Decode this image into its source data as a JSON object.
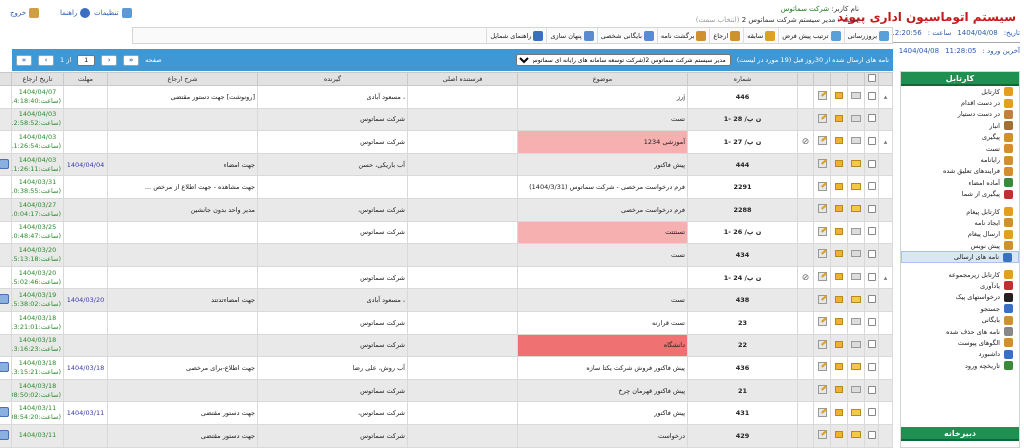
{
  "header": {
    "brand": "سیستم اتوماسیون اداری پیوند",
    "user_label": "نام کاربر:",
    "user_value": "شرکت سماتوس",
    "post_label": "سمت :",
    "post_value": "مدیر سیستم شرکت سماتوس 2",
    "post_change": "(انتخاب سمت)",
    "settings": "تنظیمات",
    "help": "راهنما",
    "exit": "خروج"
  },
  "datetime": {
    "date_label": "تاریخ:",
    "date_value": "1404/04/08",
    "time_label": "ساعت :",
    "time_value": "12:20:56",
    "last_label": "آخرین ورود :",
    "last_time": "11:28:05",
    "last_date": "1404/04/08"
  },
  "sidebar": {
    "title": "کارتابل",
    "items": [
      {
        "label": "کارتابل",
        "icon": "inbox-icon",
        "color": "#e0a020"
      },
      {
        "label": "در دست اقدام",
        "icon": "inprogress-icon",
        "color": "#e0a020"
      },
      {
        "label": "در دست دستیار",
        "icon": "assistant-icon",
        "color": "#c08040"
      },
      {
        "label": "انبار",
        "icon": "archive-icon",
        "color": "#a07030"
      },
      {
        "label": "پیگیری",
        "icon": "pencil-icon",
        "color": "#d09030"
      },
      {
        "label": "تست",
        "icon": "test-icon",
        "color": "#d09030"
      },
      {
        "label": "رایانامه",
        "icon": "email-icon",
        "color": "#d09030"
      },
      {
        "label": "فرایندهای تعلیق شده",
        "icon": "suspended-icon",
        "color": "#d09030"
      },
      {
        "label": "آماده امضاء",
        "icon": "sign-icon",
        "color": "#3a8a3a"
      },
      {
        "label": "پیگیری از شما",
        "icon": "followup-icon",
        "color": "#c03030"
      },
      {
        "label": "کارتابل پیغام",
        "icon": "message-box-icon",
        "color": "#e0a020"
      },
      {
        "label": "ایجاد نامه",
        "icon": "new-letter-icon",
        "color": "#d09030"
      },
      {
        "label": "ارسال پیغام",
        "icon": "send-message-icon",
        "color": "#e0a020"
      },
      {
        "label": "پیش نویس",
        "icon": "draft-icon",
        "color": "#d09030"
      },
      {
        "label": "نامه های ارسالی",
        "icon": "sent-letters-icon",
        "color": "#3a70c0"
      },
      {
        "label": "کارتابل زیرمجموعه",
        "icon": "sub-inbox-icon",
        "color": "#e0a020"
      },
      {
        "label": "یادآوری",
        "icon": "reminder-icon",
        "color": "#c03030"
      },
      {
        "label": "درخواستهای پیک",
        "icon": "courier-icon",
        "color": "#222222"
      },
      {
        "label": "جستجو",
        "icon": "search-icon",
        "color": "#3a70c0"
      },
      {
        "label": "بایگانی",
        "icon": "archive-folder-icon",
        "color": "#d09030"
      },
      {
        "label": "نامه های حذف شده",
        "icon": "trash-icon",
        "color": "#888888"
      },
      {
        "label": "الگوهای پیوست",
        "icon": "attachment-template-icon",
        "color": "#d09030"
      },
      {
        "label": "داشبورد",
        "icon": "dashboard-icon",
        "color": "#3a70c0"
      },
      {
        "label": "تاریخچه ورود",
        "icon": "history-icon",
        "color": "#3a8a3a"
      }
    ],
    "active_index": 14,
    "footer_title": "دبیرخانه"
  },
  "toolbar": [
    {
      "label": "بروزرسانی",
      "icon": "refresh-icon"
    },
    {
      "label": "ترتیب پیش فرض",
      "icon": "sort-icon"
    },
    {
      "label": "سابقه",
      "icon": "history-icon"
    },
    {
      "label": "ارجاع",
      "icon": "refer-icon"
    },
    {
      "label": "برگشت نامه",
      "icon": "return-icon"
    },
    {
      "label": "بایگانی شخصی",
      "icon": "personal-archive-icon"
    },
    {
      "label": "پنهان سازی",
      "icon": "hide-icon"
    },
    {
      "label": "راهنمای شمایل",
      "icon": "legend-icon"
    }
  ],
  "panel": {
    "title": "نامه های ارسال شده  از 30روز قبل (19 مورد در لیست)",
    "select_value": "مدیر سیستم شرکت سماتوس 2(شرکت توسعه سامانه های رایانه ای سماتوس)",
    "page_label": "صفحه",
    "page_value": "1",
    "page_of": "از 1"
  },
  "columns": [
    "شماره",
    "موضوع",
    "فرستنده اصلی",
    "گیرنده",
    "شرح ارجاع",
    "مهلت",
    "تاریخ ارجاع"
  ],
  "rows": [
    {
      "num": "446",
      "subject": "jرز",
      "sender": "",
      "receiver": "، مسعود آبادی",
      "desc": "[رونوشت] جهت دستور مقتضی",
      "due": "",
      "date": "1404/04/07",
      "time": "(ساعت:14:18:40)",
      "bg": "",
      "attach": false,
      "env": "closed",
      "expand": true,
      "sign": false
    },
    {
      "num": "ن پ/ 28 -1",
      "subject": "تست",
      "sender": "",
      "receiver": "شرکت سماتوس",
      "desc": "",
      "due": "",
      "date": "1404/04/03",
      "time": "(ساعت:12:58:52)",
      "bg": "",
      "attach": false,
      "env": "closed",
      "expand": false,
      "sign": false
    },
    {
      "num": "ن پ/ 27 -1",
      "subject": "آموزشی 1234",
      "sender": "",
      "receiver": "شرکت سماتوس",
      "desc": "",
      "due": "",
      "date": "1404/04/03",
      "time": "(ساعت:11:26:54)",
      "bg": "pink",
      "attach": true,
      "env": "closed",
      "expand": true,
      "sign": false
    },
    {
      "num": "444",
      "subject": "پیش فاکتور",
      "sender": "",
      "receiver": "آب باریکی، حسن",
      "desc": "جهت امضاء",
      "due": "1404/04/04",
      "date": "1404/04/03",
      "time": "(ساعت:11:26:11)",
      "bg": "",
      "attach": false,
      "env": "open",
      "expand": false,
      "sign": true
    },
    {
      "num": "2291",
      "subject": "فرم درخواست مرخصی - شرکت سماتوس (1404/3/31)",
      "sender": "",
      "receiver": "",
      "desc": "جهت مشاهده - جهت اطلاع از مرخص ...",
      "due": "",
      "date": "1404/03/31",
      "time": "(ساعت:10:38:55)",
      "bg": "",
      "attach": false,
      "env": "open",
      "expand": false,
      "sign": false
    },
    {
      "num": "2288",
      "subject": "فرم درخواست مرخصی",
      "sender": "",
      "receiver": "شرکت سماتوس،",
      "desc": "مدیر واحد بدون جانشین",
      "due": "",
      "date": "1404/03/27",
      "time": "(ساعت:10:04:17)",
      "bg": "",
      "attach": false,
      "env": "open",
      "expand": false,
      "sign": false
    },
    {
      "num": "ن پ/ 26 -1",
      "subject": "تستتتت",
      "sender": "",
      "receiver": "شرکت سماتوس",
      "desc": "",
      "due": "",
      "date": "1404/03/25",
      "time": "(ساعت:10:48:47)",
      "bg": "pink",
      "attach": false,
      "env": "closed",
      "expand": false,
      "sign": false
    },
    {
      "num": "434",
      "subject": "تست",
      "sender": "",
      "receiver": "",
      "desc": "",
      "due": "",
      "date": "1404/03/20",
      "time": "(ساعت:15:13:18)",
      "bg": "",
      "attach": false,
      "env": "closed",
      "expand": false,
      "sign": false
    },
    {
      "num": "ن پ/ 24 -1",
      "subject": "",
      "sender": "",
      "receiver": "شرکت سماتوس",
      "desc": "",
      "due": "",
      "date": "1404/03/20",
      "time": "(ساعت:15:02:46)",
      "bg": "",
      "attach": true,
      "env": "closed",
      "expand": true,
      "sign": false
    },
    {
      "num": "438",
      "subject": "تست",
      "sender": "",
      "receiver": "، مسعود آبادی",
      "desc": "جهت امضاءتدتتد",
      "due": "1404/03/20",
      "date": "1404/03/19",
      "time": "(ساعت:15:38:02)",
      "bg": "",
      "attach": false,
      "env": "open",
      "expand": false,
      "sign": true
    },
    {
      "num": "23",
      "subject": "تست قرارنه",
      "sender": "",
      "receiver": "شرکت سماتوس",
      "desc": "",
      "due": "",
      "date": "1404/03/18",
      "time": "(ساعت:13:21:01)",
      "bg": "",
      "attach": false,
      "env": "closed",
      "expand": false,
      "sign": false
    },
    {
      "num": "22",
      "subject": "دانشگاه",
      "sender": "",
      "receiver": "شرکت سماتوس",
      "desc": "",
      "due": "",
      "date": "1404/03/18",
      "time": "(ساعت:13:16:23)",
      "bg": "red",
      "attach": false,
      "env": "closed",
      "expand": false,
      "sign": false
    },
    {
      "num": "436",
      "subject": "پیش فاکتور فروش شرکت یکتا سازه",
      "sender": "",
      "receiver": "آب روش، علی رضا",
      "desc": "جهت اطلاع-برای مرخصی",
      "due": "1404/03/18",
      "date": "1404/03/18",
      "time": "(ساعت:13:15:21)",
      "bg": "",
      "attach": false,
      "env": "open",
      "expand": false,
      "sign": true
    },
    {
      "num": "21",
      "subject": "پیش فاکتور قهرمان چرخ",
      "sender": "",
      "receiver": "شرکت سماتوس",
      "desc": "",
      "due": "",
      "date": "1404/03/18",
      "time": "(ساعت:08:50:02)",
      "bg": "",
      "attach": false,
      "env": "closed",
      "expand": false,
      "sign": false
    },
    {
      "num": "431",
      "subject": "پیش فاکتور",
      "sender": "",
      "receiver": "شرکت سماتوس،",
      "desc": "جهت دستور مقتضی",
      "due": "1404/03/11",
      "date": "1404/03/11",
      "time": "(ساعت:08:54:20)",
      "bg": "",
      "attach": false,
      "env": "open",
      "expand": false,
      "sign": true
    },
    {
      "num": "429",
      "subject": "درخواست",
      "sender": "",
      "receiver": "شرکت سماتوس",
      "desc": "جهت دستور مقتضی",
      "due": "",
      "date": "1404/03/11",
      "time": "",
      "bg": "",
      "attach": false,
      "env": "open",
      "expand": false,
      "sign": true
    }
  ]
}
